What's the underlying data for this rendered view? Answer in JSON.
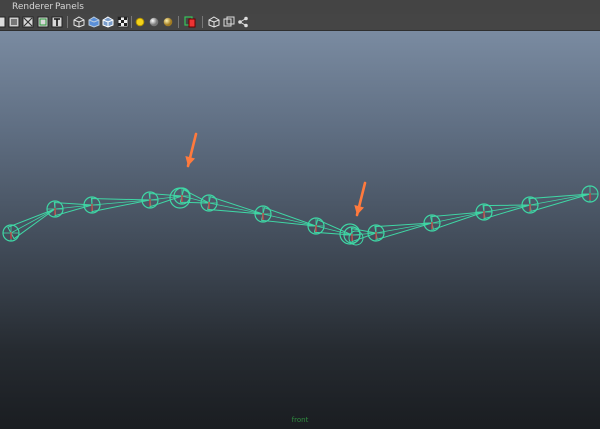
{
  "menubar": {
    "items": [
      {
        "label": "Renderer"
      },
      {
        "label": "Panels"
      }
    ]
  },
  "toolbar": {
    "icons": [
      "select-camera-icon",
      "camera-attributes-icon",
      "wireframe-grid-icon",
      "film-gate-icon",
      "text-t-icon",
      "wireframe-shaded-icon",
      "smooth-shade-icon",
      "wireframe-on-shaded-icon",
      "textured-icon",
      "use-all-lights-icon",
      "default-light-sphere-icon",
      "shadows-sphere-icon",
      "xray-selection-icon",
      "isolate-select-icon",
      "wireframe-cube-icon",
      "share-nodes-icon"
    ]
  },
  "viewport": {
    "camera_label": "front",
    "colors": {
      "joint": "#3fd7a5",
      "bone_axis": "#d04040",
      "arrow": "#ff7a3d"
    }
  }
}
